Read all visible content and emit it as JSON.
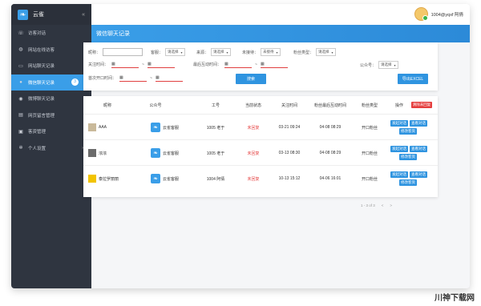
{
  "app": {
    "name": "云雀",
    "collapse_icon": "double-chevron-left-icon"
  },
  "user": {
    "name": "1004@yqxf 阿倩"
  },
  "sidebar": {
    "items": [
      {
        "label": "访客对话",
        "icon": "phone-icon"
      },
      {
        "label": "网站在线访客",
        "icon": "globe-icon"
      },
      {
        "label": "网站聊天记录",
        "icon": "chat-icon"
      },
      {
        "label": "微信聊天记录",
        "icon": "wechat-icon",
        "active": true,
        "badge": "3"
      },
      {
        "label": "微博聊天记录",
        "icon": "weibo-icon"
      },
      {
        "label": "网页留言管理",
        "icon": "doc-icon"
      },
      {
        "label": "客资管理",
        "icon": "save-icon"
      },
      {
        "label": "个人设置",
        "icon": "gear-icon",
        "has_arrow": true
      }
    ]
  },
  "page_title": "微信聊天记录",
  "filters": {
    "nickname_label": "昵称：",
    "sort_label": "客服：",
    "sort_value": "请选择",
    "source_label": "来源：",
    "source_value": "请选择",
    "accept_label": "未接待：",
    "accept_value": "未接待",
    "fans_type_label": "粉丝类型：",
    "fans_type_value": "请选择",
    "follow_time_label": "关注时间：",
    "tilde": "~",
    "last_interact_label": "最后互动时间：",
    "account_label": "公众号：",
    "account_value": "请选择",
    "first_open_label": "首次开口时间：",
    "search_button": "搜索",
    "export_button": "导出EXCEL"
  },
  "table": {
    "headers": [
      "昵称",
      "公众号",
      "工号",
      "当前状态",
      "关注时间",
      "粉丝最后互动时间",
      "粉丝类型",
      "操作"
    ],
    "batch_button": "清除未回复",
    "rows": [
      {
        "nickname": "AAA",
        "account": "云雀客服",
        "staff": "1005 老于",
        "status": "未回复",
        "follow_time": "03-21 09:24",
        "last_interact": "04-08 08:29",
        "fans_type": "开口粉丝",
        "actions": [
          "发起对话",
          "查看对话",
          "修改客资"
        ]
      },
      {
        "nickname": "浓浓",
        "account": "云雀客服",
        "staff": "1005 老于",
        "status": "未回复",
        "follow_time": "03-13 08:30",
        "last_interact": "04-08 08:29",
        "fans_type": "开口粉丝",
        "actions": [
          "发起对话",
          "查看对话",
          "修改客资"
        ]
      },
      {
        "nickname": "泰拉罗丽丽",
        "account": "云雀客服",
        "staff": "1004 阿倩",
        "status": "未回复",
        "follow_time": "10-13 15:12",
        "last_interact": "04-06 16:01",
        "fans_type": "开口粉丝",
        "actions": [
          "发起对话",
          "查看对话",
          "修改客资"
        ]
      }
    ]
  },
  "pagination": {
    "info": "1 - 3 of 3",
    "prev": "<",
    "next": ">"
  },
  "watermark": "川神下载网"
}
